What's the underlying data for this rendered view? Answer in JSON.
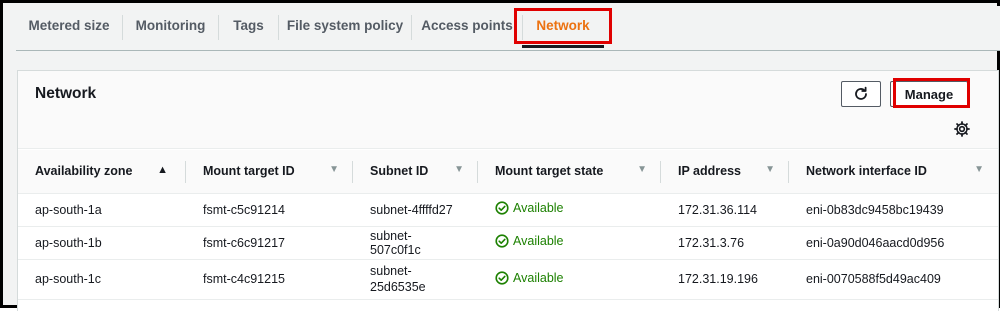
{
  "tabs": [
    {
      "label": "Metered size"
    },
    {
      "label": "Monitoring"
    },
    {
      "label": "Tags"
    },
    {
      "label": "File system policy"
    },
    {
      "label": "Access points"
    },
    {
      "label": "Network",
      "active": true
    }
  ],
  "panel": {
    "title": "Network",
    "manage_label": "Manage"
  },
  "table": {
    "columns": [
      "Availability zone",
      "Mount target ID",
      "Subnet ID",
      "Mount target state",
      "IP address",
      "Network interface ID"
    ],
    "rows": [
      {
        "az": "ap-south-1a",
        "mount_target_id": "fsmt-c5c91214",
        "subnet_id": "subnet-4ffffd27",
        "state": "Available",
        "ip": "172.31.36.114",
        "eni": "eni-0b83dc9458bc19439"
      },
      {
        "az": "ap-south-1b",
        "mount_target_id": "fsmt-c6c91217",
        "subnet_id": "subnet-507c0f1c",
        "state": "Available",
        "ip": "172.31.3.76",
        "eni": "eni-0a90d046aacd0d956"
      },
      {
        "az": "ap-south-1c",
        "mount_target_id": "fsmt-c4c91215",
        "subnet_id_line1": "subnet-",
        "subnet_id_line2": "25d6535e",
        "state": "Available",
        "ip": "172.31.19.196",
        "eni": "eni-0070588f5d49ac409"
      }
    ]
  },
  "colors": {
    "active_tab": "#ec7211",
    "available": "#1d8102",
    "highlight_box": "#e00000"
  },
  "icons": [
    "refresh-icon",
    "settings-gear-icon",
    "status-check-icon",
    "sort-ascending-icon",
    "sort-icon"
  ]
}
